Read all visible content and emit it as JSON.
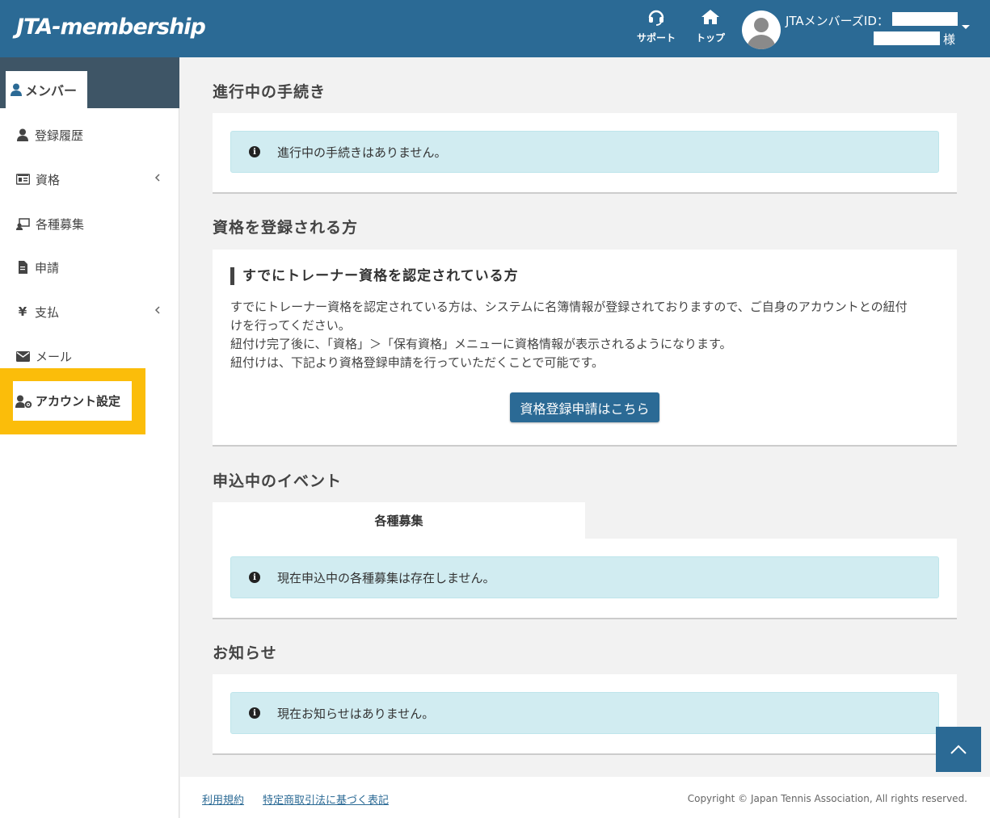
{
  "header": {
    "logo": "JTA-membership",
    "support_label": "サポート",
    "top_label": "トップ",
    "member_id_label": "JTAメンバーズID：",
    "honorific": "様"
  },
  "sidebar": {
    "member_tab": "メンバー",
    "items": [
      {
        "label": "登録履歴",
        "icon": "user-icon"
      },
      {
        "label": "資格",
        "icon": "id-card-icon"
      },
      {
        "label": "各種募集",
        "icon": "recruit-icon"
      },
      {
        "label": "申請",
        "icon": "file-icon"
      },
      {
        "label": "支払",
        "icon": "yen-icon"
      },
      {
        "label": "メール",
        "icon": "envelope-icon"
      }
    ],
    "account_settings": "アカウント設定",
    "highlight_color": "#fbbd0a"
  },
  "sections": {
    "ongoing": {
      "title": "進行中の手続き",
      "info": "進行中の手続きはありません。"
    },
    "register": {
      "title": "資格を登録される方",
      "subtitle": "すでにトレーナー資格を認定されている方",
      "line1": "すでにトレーナー資格を認定されている方は、システムに名簿情報が登録されておりますので、ご自身のアカウントとの紐付",
      "line2": "けを行ってください。",
      "line3": "紐付け完了後に、「資格」＞「保有資格」メニューに資格情報が表示されるようになります。",
      "line4": "紐付けは、下記より資格登録申請を行っていただくことで可能です。",
      "button": "資格登録申請はこちら"
    },
    "events": {
      "title": "申込中のイベント",
      "tab": "各種募集",
      "info": "現在申込中の各種募集は存在しません。"
    },
    "news": {
      "title": "お知らせ",
      "info": "現在お知らせはありません。"
    }
  },
  "footer": {
    "terms": "利用規約",
    "commerce": "特定商取引法に基づく表記",
    "copyright": "Copyright © Japan Tennis Association, All rights reserved."
  },
  "colors": {
    "primary": "#2b6a95",
    "info_bg": "#d1ecf1"
  }
}
